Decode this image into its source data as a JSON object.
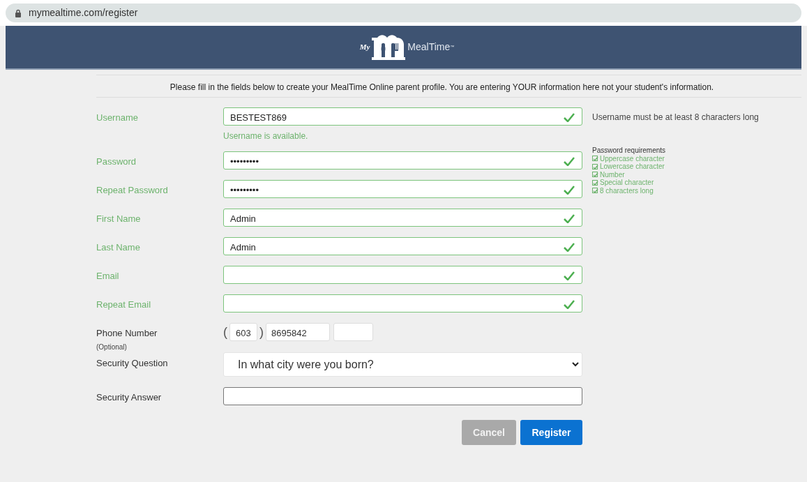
{
  "address_bar": {
    "url": "mymealtime.com/register"
  },
  "logo": {
    "prefix": "My",
    "name": "MealTime",
    "mark": "™"
  },
  "intro": "Please fill in the fields below to create your MealTime Online parent profile. You are entering YOUR information here not your student's information.",
  "fields": [
    {
      "label": "Username",
      "value": "BESTEST869",
      "valid": true,
      "message": "Username is available.",
      "hint": "Username must be at least 8 characters long"
    },
    {
      "label": "Password",
      "value": "•••••••••",
      "valid": true
    },
    {
      "label": "Repeat Password",
      "value": "•••••••••",
      "valid": true
    },
    {
      "label": "First Name",
      "value": "Admin",
      "valid": true
    },
    {
      "label": "Last Name",
      "value": "Admin",
      "valid": true
    },
    {
      "label": "Email",
      "valid": true
    },
    {
      "label": "Repeat Email",
      "valid": true
    }
  ],
  "password_requirements": {
    "title": "Password requirements",
    "items": [
      {
        "label": "Uppercase character",
        "checked": true
      },
      {
        "label": "Lowercase character",
        "checked": true
      },
      {
        "label": "Number",
        "checked": true
      },
      {
        "label": "Special character",
        "checked": true
      },
      {
        "label": "8 characters long",
        "checked": true
      }
    ]
  },
  "phone": {
    "label": "Phone Number",
    "note": "(Optional)",
    "open_paren": "(",
    "close_paren": ")",
    "area_code": "603",
    "number": "8695842"
  },
  "security_question": {
    "label": "Security Question",
    "value": "In what city were you born?"
  },
  "security_answer": {
    "label": "Security Answer"
  },
  "buttons": [
    {
      "label": "Cancel",
      "kind": "secondary"
    },
    {
      "label": "Register",
      "kind": "primary"
    }
  ]
}
